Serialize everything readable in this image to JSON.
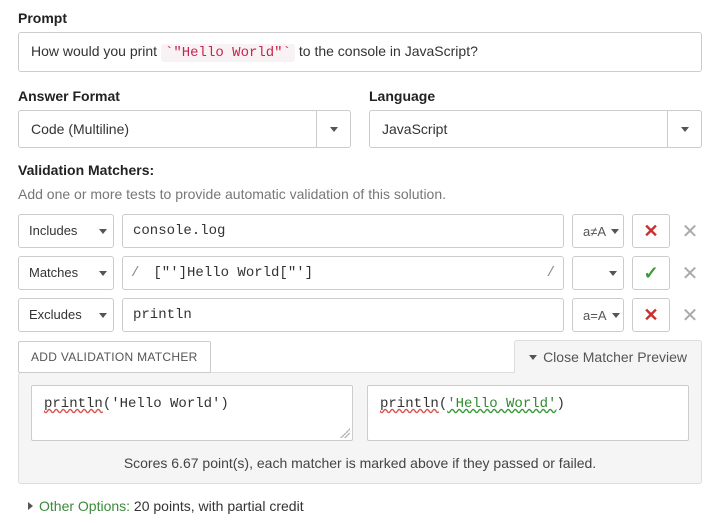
{
  "prompt": {
    "label": "Prompt",
    "text_before": "How would you print ",
    "code": "`\"Hello World\"`",
    "text_after": " to the console in JavaScript?"
  },
  "answer_format": {
    "label": "Answer Format",
    "value": "Code (Multiline)"
  },
  "language": {
    "label": "Language",
    "value": "JavaScript"
  },
  "validation": {
    "label": "Validation Matchers:",
    "helper": "Add one or more tests to provide automatic validation of this solution.",
    "matchers": [
      {
        "type": "Includes",
        "value": "console.log",
        "flag": "a≠A",
        "result": "fail",
        "slash": false
      },
      {
        "type": "Matches",
        "value": "[\"']Hello World[\"']",
        "flag": "",
        "result": "pass",
        "slash": true
      },
      {
        "type": "Excludes",
        "value": "println",
        "flag": "a=A",
        "result": "fail",
        "slash": false
      }
    ],
    "add_button": "Add Validation Matcher",
    "preview_toggle": "Close Matcher Preview"
  },
  "preview": {
    "left_fn": "println",
    "left_arg": "('Hello World')",
    "right_fn": "println",
    "right_paren_open": "(",
    "right_str": "'Hello World'",
    "right_paren_close": ")",
    "score_text": "Scores 6.67 point(s), each matcher is marked above if they passed or failed."
  },
  "other_options": {
    "label": "Other Options:",
    "text": " 20 points, with partial credit"
  }
}
